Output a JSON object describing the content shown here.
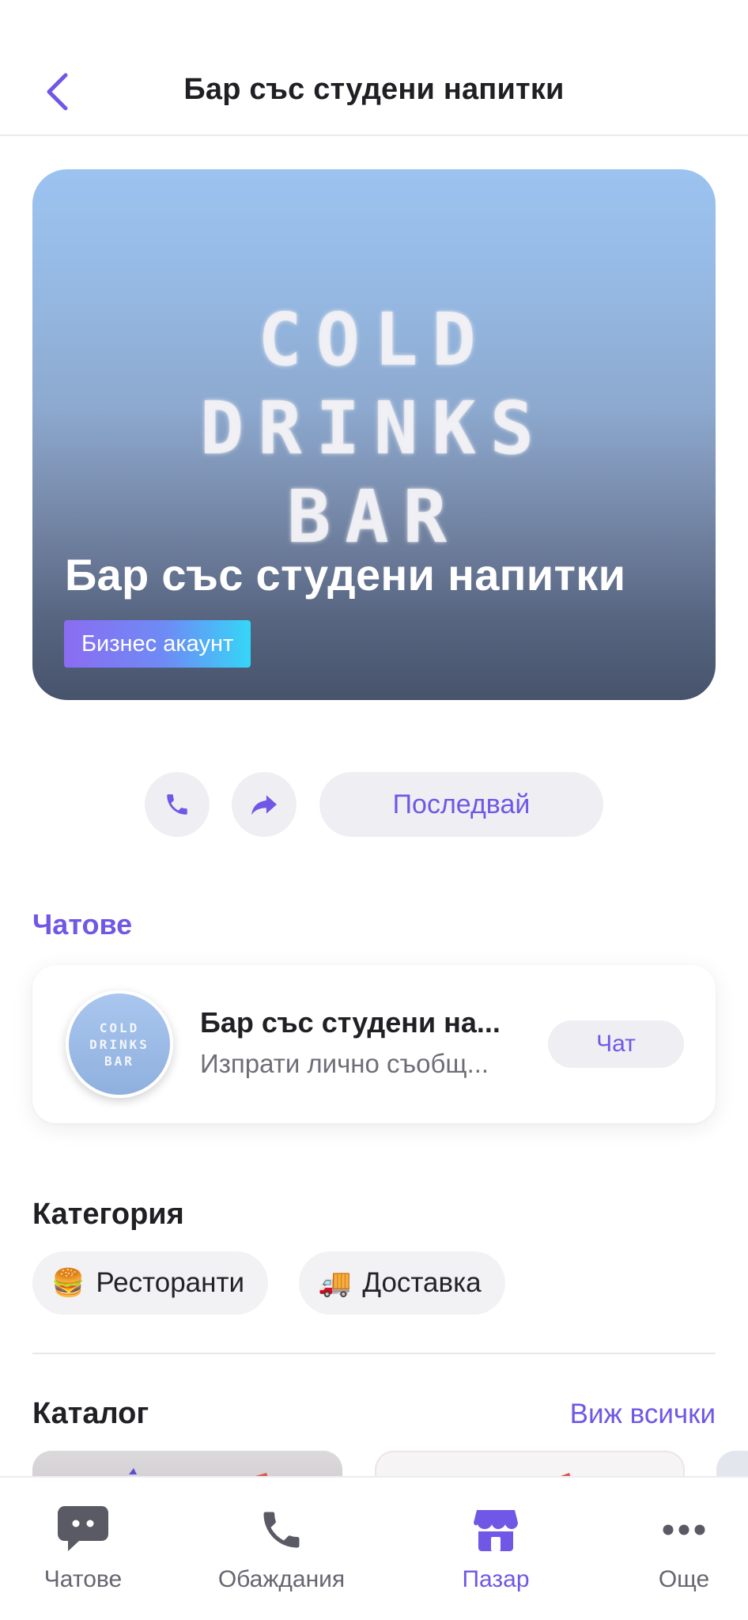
{
  "header": {
    "title": "Бар със студени напитки"
  },
  "hero": {
    "logo_lines": [
      "COLD",
      "DRINKS",
      "BAR"
    ],
    "title": "Бар със студени напитки",
    "badge": "Бизнес акаунт"
  },
  "actions": {
    "follow_label": "Последвай"
  },
  "chats": {
    "section_title": "Чатове",
    "item": {
      "avatar_lines": [
        "COLD",
        "DRINKS",
        "BAR"
      ],
      "name": "Бар със студени на...",
      "subtitle": "Изпрати лично съобщ...",
      "button": "Чат"
    }
  },
  "category": {
    "title": "Категория",
    "chips": [
      {
        "emoji": "🍔",
        "label": "Ресторанти"
      },
      {
        "emoji": "🚚",
        "label": "Доставка"
      }
    ]
  },
  "catalog": {
    "title": "Каталог",
    "see_all": "Виж всички"
  },
  "bottom_nav": {
    "items": [
      {
        "label": "Чатове",
        "icon": "chat-bubble-icon"
      },
      {
        "label": "Обаждания",
        "icon": "phone-icon"
      },
      {
        "label": "Пазар",
        "icon": "store-icon",
        "active": true
      },
      {
        "label": "Още",
        "icon": "more-dots-icon"
      }
    ]
  },
  "colors": {
    "accent": "#7057e6",
    "chip_bg": "#f2f2f5",
    "text": "#1f1f24"
  }
}
